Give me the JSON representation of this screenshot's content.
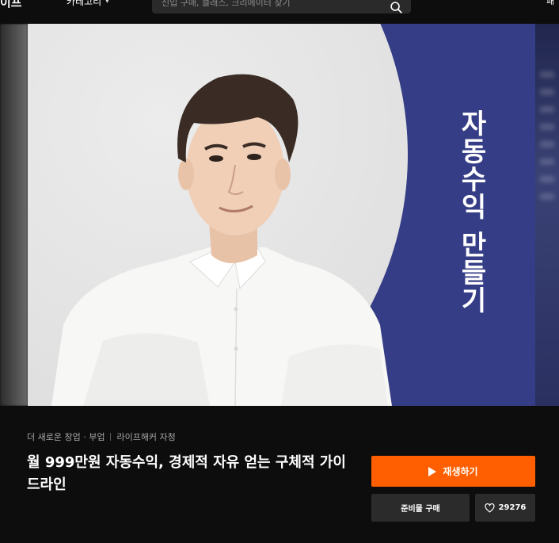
{
  "header": {
    "logo_text": "이프",
    "category_label": "카테고리",
    "search_placeholder": "신입 구매, 클래스, 크리에이터 찾기",
    "topright_label": "패"
  },
  "hero": {
    "vertical_title": "자동수익 만들기",
    "banner_color": "#343d85"
  },
  "course": {
    "category": "더 새로운 창업 · 부업",
    "creator": "라이프해커 자청",
    "title": "월 999만원 자동수익, 경제적 자유 얻는 구체적 가이드라인",
    "play_label": "재생하기",
    "buy_label": "준비물 구매",
    "like_count": "29276",
    "accent_color": "#ff5f00"
  }
}
